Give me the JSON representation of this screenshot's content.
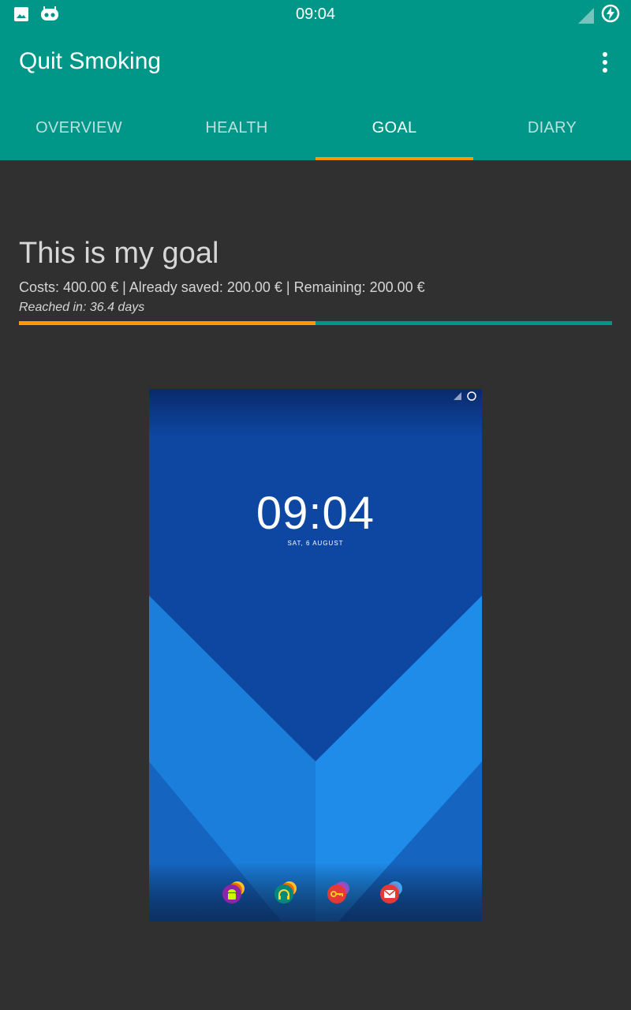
{
  "status_bar": {
    "time": "09:04",
    "left_icons": [
      "image-icon",
      "cyanogen-icon"
    ],
    "right_icons": [
      "signal-icon",
      "battery-charging-icon"
    ]
  },
  "app_bar": {
    "title": "Quit Smoking",
    "menu_icon": "more-vert-icon"
  },
  "tabs": [
    {
      "label": "OVERVIEW",
      "active": false
    },
    {
      "label": "HEALTH",
      "active": false
    },
    {
      "label": "GOAL",
      "active": true
    },
    {
      "label": "DIARY",
      "active": false
    }
  ],
  "goal": {
    "title": "This is my goal",
    "stats": "Costs: 400.00 € | Already saved: 200.00 € | Remaining: 200.00 €",
    "reached": "Reached in: 36.4 days",
    "progress": 0.5
  },
  "goal_image": {
    "time": "09:04",
    "date": "SAT, 6 AUGUST",
    "dock_icons": [
      "android-icon",
      "headphones-icon",
      "key-icon",
      "mail-icon"
    ]
  },
  "colors": {
    "primary": "#009688",
    "accent": "#ff9800",
    "background": "#303030",
    "text": "#d6d6d6"
  }
}
